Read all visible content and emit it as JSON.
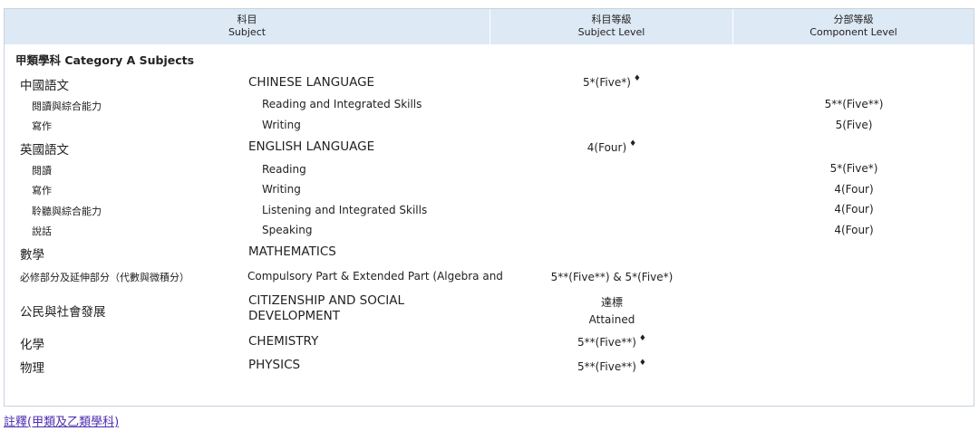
{
  "header": {
    "col1": {
      "zh": "科目",
      "en": "Subject"
    },
    "col2": {
      "zh": "科目等級",
      "en": "Subject Level"
    },
    "col3": {
      "zh": "分部等級",
      "en": "Component Level"
    }
  },
  "category_a": "甲類學科 Category A Subjects",
  "rows": [
    {
      "zh": "中國語文",
      "en": "CHINESE LANGUAGE",
      "level": "5*(Five*)",
      "component": ""
    },
    {
      "zh": "閱讀與綜合能力",
      "en": "Reading and Integrated Skills",
      "level": "",
      "component": "5**(Five**)"
    },
    {
      "zh": "寫作",
      "en": "Writing",
      "level": "",
      "component": "5(Five)"
    },
    {
      "zh": "英國語文",
      "en": "ENGLISH LANGUAGE",
      "level": "4(Four)",
      "component": ""
    },
    {
      "zh": "閱讀",
      "en": "Reading",
      "level": "",
      "component": "5*(Five*)"
    },
    {
      "zh": "寫作",
      "en": "Writing",
      "level": "",
      "component": "4(Four)"
    },
    {
      "zh": "聆聽與綜合能力",
      "en": "Listening and Integrated Skills",
      "level": "",
      "component": "4(Four)"
    },
    {
      "zh": "說話",
      "en": "Speaking",
      "level": "",
      "component": "4(Four)"
    },
    {
      "zh": "數學",
      "en": "MATHEMATICS",
      "level": "",
      "component": ""
    },
    {
      "zh": "必修部分及延伸部分（代數與微積分）",
      "en": "Compulsory Part & Extended Part (Algebra and",
      "level": "5**(Five**) & 5*(Five*)",
      "component": ""
    },
    {
      "zh": "公民與社會發展",
      "en_line1": "CITIZENSHIP AND SOCIAL",
      "en_line2": "DEVELOPMENT",
      "level_zh": "達標",
      "level_en": "Attained"
    },
    {
      "zh": "化學",
      "en": "CHEMISTRY",
      "level": "5**(Five**)",
      "component": ""
    },
    {
      "zh": "物理",
      "en": "PHYSICS",
      "level": "5**(Five**)",
      "component": ""
    }
  ],
  "diamond": "♦",
  "footer_link": "註釋(甲類及乙類學科)"
}
